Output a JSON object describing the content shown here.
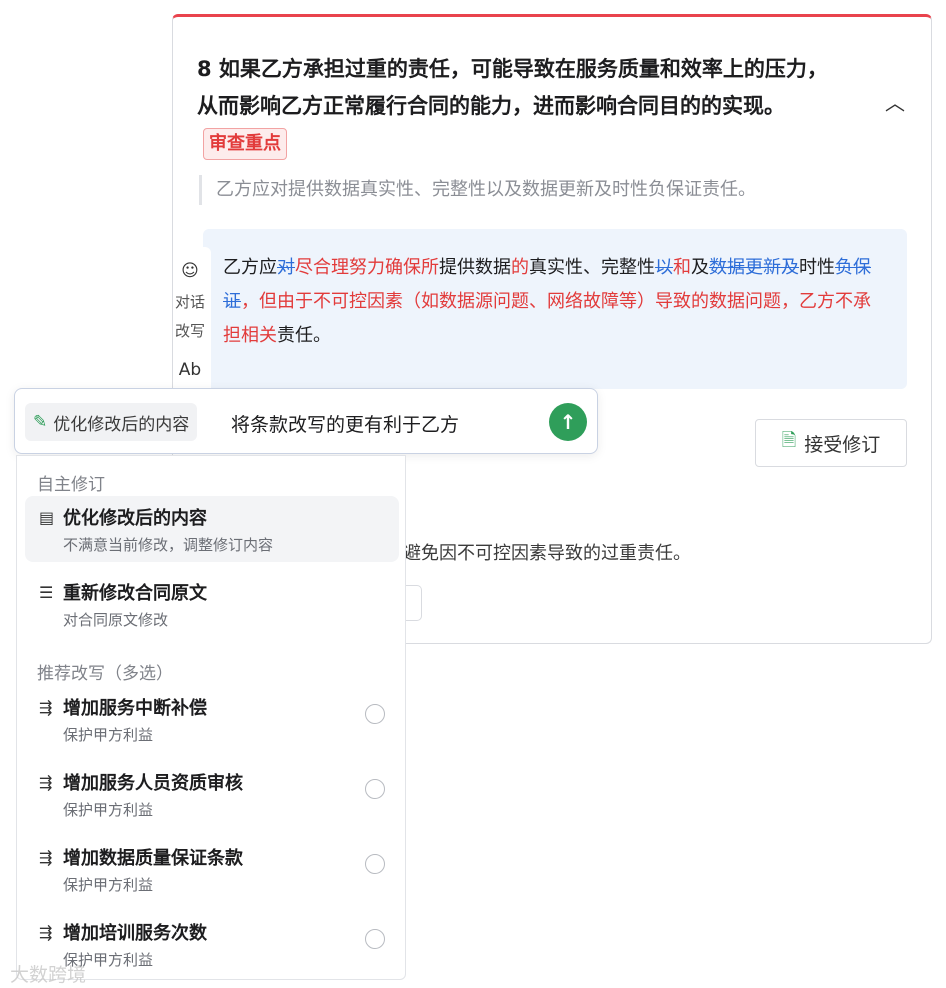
{
  "issue": {
    "title": "8 如果乙方承担过重的责任，可能导致在服务质量和效率上的压力，从而影响乙方正常履行合同的能力，进而影响合同目的的实现。",
    "badge": "审查重点",
    "collapse_icon": "chevron-up-icon",
    "quote": "乙方应对提供数据真实性、完整性以及数据更新及时性负保证责任。"
  },
  "revision": {
    "segments": [
      {
        "text": "乙方应",
        "type": "normal"
      },
      {
        "text": "对",
        "type": "deleted"
      },
      {
        "text": "尽合理努力确保所",
        "type": "inserted"
      },
      {
        "text": "提供数据",
        "type": "normal"
      },
      {
        "text": "的",
        "type": "inserted"
      },
      {
        "text": "真实性、完整性",
        "type": "normal"
      },
      {
        "text": "以",
        "type": "deleted"
      },
      {
        "text": "和",
        "type": "inserted"
      },
      {
        "text": "及",
        "type": "normal"
      },
      {
        "text": "数据更新及",
        "type": "deleted"
      },
      {
        "text": "时性",
        "type": "normal"
      },
      {
        "text": "负保证",
        "type": "deleted"
      },
      {
        "text": "，但由于不可控因素（如数据源问题、网络故障等）导致的数据问题，乙方不承担相关",
        "type": "inserted"
      },
      {
        "text": "责任。",
        "type": "normal"
      }
    ]
  },
  "side_tools": {
    "chat_label_1": "对话",
    "chat_label_2": "改写",
    "chat_icon": "chat-icon",
    "font_icon": "text-style-icon"
  },
  "accept": {
    "label": "接受修订",
    "icon": "document-check-icon"
  },
  "background_text": "避免因不可控因素导致的过重责任。",
  "input_bar": {
    "chip_label": "优化修改后的内容",
    "chip_icon": "edit-doc-icon",
    "value": "将条款改写的更有利于乙方",
    "send_icon": "arrow-up-icon"
  },
  "dropdown": {
    "section1": "自主修订",
    "section2": "推荐改写（多选）",
    "custom_options": [
      {
        "title": "优化修改后的内容",
        "subtitle": "不满意当前修改，调整修订内容",
        "icon": "edit-doc-icon"
      },
      {
        "title": "重新修改合同原文",
        "subtitle": "对合同原文修改",
        "icon": "list-icon"
      }
    ],
    "recommended": [
      {
        "title": "增加服务中断补偿",
        "subtitle": "保护甲方利益",
        "icon": "rewrite-icon"
      },
      {
        "title": "增加服务人员资质审核",
        "subtitle": "保护甲方利益",
        "icon": "rewrite-icon"
      },
      {
        "title": "增加数据质量保证条款",
        "subtitle": "保护甲方利益",
        "icon": "rewrite-icon"
      },
      {
        "title": "增加培训服务次数",
        "subtitle": "保护甲方利益",
        "icon": "rewrite-icon"
      }
    ]
  },
  "watermark": "大数跨境"
}
